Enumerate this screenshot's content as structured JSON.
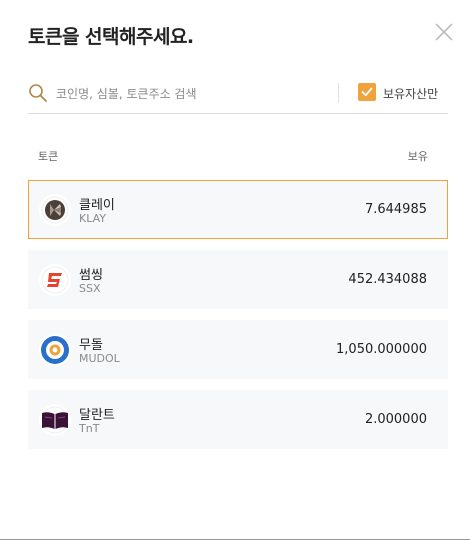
{
  "modal": {
    "title": "토큰을 선택해주세요."
  },
  "search": {
    "placeholder": "코인명, 심볼, 토큰주소 검색",
    "value": ""
  },
  "filter": {
    "label": "보유자산만",
    "checked": true
  },
  "columns": {
    "token": "토큰",
    "holding": "보유"
  },
  "tokens": [
    {
      "name": "클레이",
      "symbol": "KLAY",
      "balance": "7.644985",
      "icon": "klay-logo-icon",
      "selected": true
    },
    {
      "name": "썸씽",
      "symbol": "SSX",
      "balance": "452.434088",
      "icon": "ssx-logo-icon",
      "selected": false
    },
    {
      "name": "무돌",
      "symbol": "MUDOL",
      "balance": "1,050.000000",
      "icon": "mudol-logo-icon",
      "selected": false
    },
    {
      "name": "달란트",
      "symbol": "TnT",
      "balance": "2.000000",
      "icon": "tnt-logo-icon",
      "selected": false
    }
  ],
  "colors": {
    "accent": "#f0a23c",
    "row_bg": "#f7f8fa"
  }
}
